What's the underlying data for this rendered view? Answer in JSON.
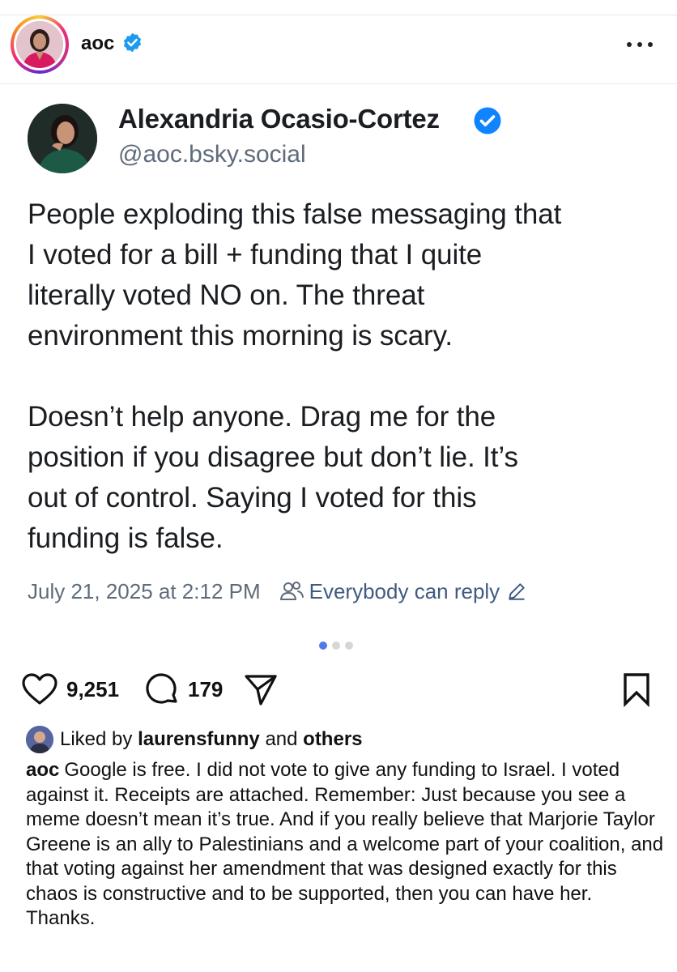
{
  "header": {
    "username": "aoc",
    "more_label": "more options"
  },
  "card": {
    "display_name": "Alexandria Ocasio-Cortez",
    "handle": "@aoc.bsky.social",
    "paragraphs": [
      "People exploding this false messaging that\nI voted for a bill + funding that I quite\nliterally voted NO on. The threat\nenvironment this morning is scary.",
      "Doesn’t help anyone. Drag me for the\nposition if you disagree but don’t lie. It’s\nout of control. Saying I voted for this\nfunding is false."
    ],
    "timestamp": "July 21, 2025 at 2:12 PM",
    "reply_setting": "Everybody can reply"
  },
  "carousel": {
    "total": 3,
    "active": 1
  },
  "actions": {
    "likes_count": "9,251",
    "comments_count": "179"
  },
  "likes": {
    "prefix": "Liked by",
    "user": "laurensfunny",
    "conjunction": "and",
    "others": "others"
  },
  "caption": {
    "username": "aoc",
    "text": "Google is free. I did not vote to give any funding to Israel. I voted against it. Receipts are attached. Remember: Just because you see a meme doesn’t mean it’s true. And if you really believe that Marjorie Taylor Greene is an ally to Palestinians and a welcome part of your coalition, and that voting against her amendment that was designed exactly for this chaos is constructive and to be supported, then you can have her. Thanks."
  },
  "colors": {
    "verified": "#1d9bf0",
    "bluesky_verified": "#1083fe",
    "dot_active": "#4f7be8",
    "meta_gray": "#5f6b7a"
  },
  "icons": [
    "verified-badge-icon",
    "more-dots-icon",
    "people-icon",
    "pencil-icon",
    "heart-icon",
    "comment-icon",
    "share-icon",
    "bookmark-icon"
  ]
}
